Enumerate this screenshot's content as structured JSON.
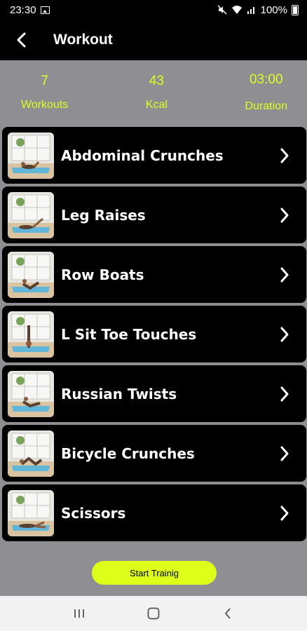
{
  "status_bar": {
    "time": "23:30",
    "battery": "100%"
  },
  "header": {
    "title": "Workout"
  },
  "stats": [
    {
      "value": "7",
      "label": "Workouts"
    },
    {
      "value": "43",
      "label": "Kcal"
    },
    {
      "value": "03:00",
      "label": "Duration"
    }
  ],
  "exercises": [
    {
      "name": "Abdominal Crunches"
    },
    {
      "name": "Leg Raises"
    },
    {
      "name": "Row Boats"
    },
    {
      "name": "L Sit Toe Touches"
    },
    {
      "name": "Russian Twists"
    },
    {
      "name": "Bicycle Crunches"
    },
    {
      "name": "Scissors"
    }
  ],
  "start_button": {
    "label": "Start Trainig"
  },
  "colors": {
    "accent": "#ddff1a",
    "background": "#8e8e93",
    "card": "#000000"
  }
}
